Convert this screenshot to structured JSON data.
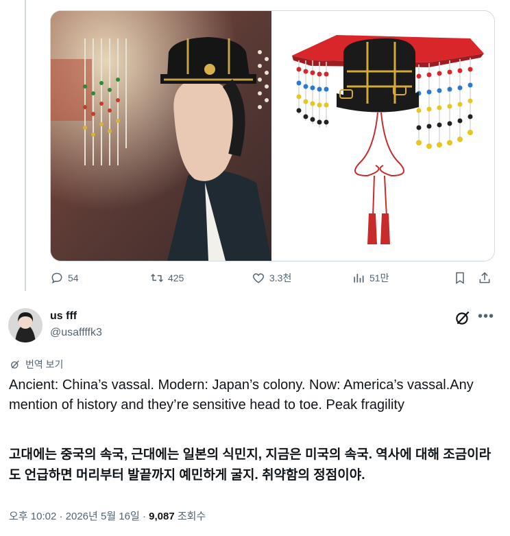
{
  "prev_tweet": {
    "actions": {
      "replies": "54",
      "reposts": "425",
      "likes": "3.3천",
      "views": "51만"
    }
  },
  "tweet": {
    "display_name": "us fff",
    "handle": "@usaffffk3",
    "translate_label": "번역 보기",
    "text_en": "Ancient: China’s vassal. Modern: Japan’s colony. Now: America’s vassal.Any mention of history and they’re sensitive head to toe. Peak fragility",
    "text_ko": "고대에는 중국의 속국, 근대에는 일본의 식민지, 지금은 미국의 속국. 역사에 대해 조금이라도 언급하면 머리부터 발끝까지 예민하게 굴지. 취약함의 정점이야.",
    "time": "오후 10:02",
    "date": "2026년 5월 16일",
    "views_count": "9,087",
    "views_label": "조회수",
    "separator": "·"
  },
  "colors": {
    "secondary_text": "#536471",
    "primary_text": "#0f1419",
    "border": "#cfd9de"
  }
}
